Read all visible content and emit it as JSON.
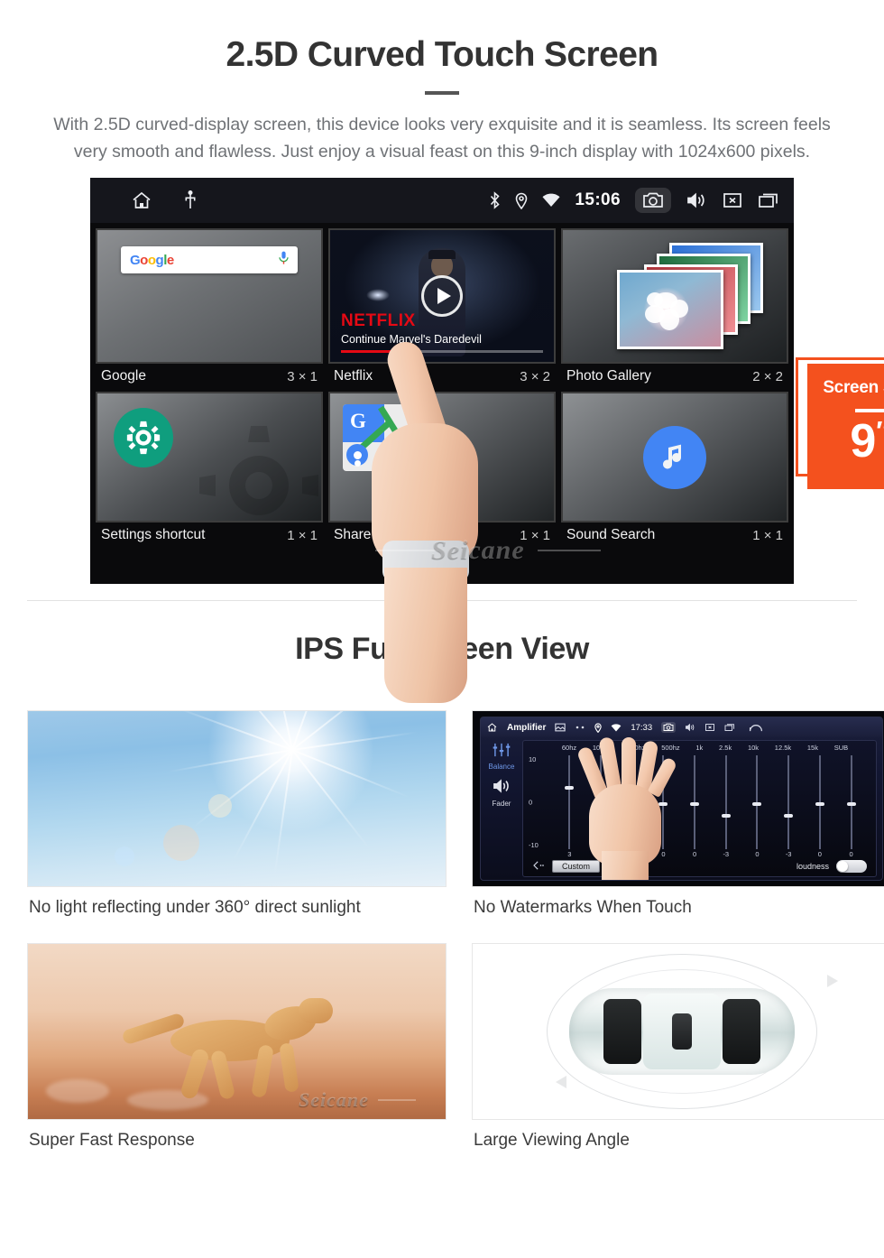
{
  "section1": {
    "title": "2.5D Curved Touch Screen",
    "description": "With 2.5D curved-display screen, this device looks very exquisite and it is seamless. Its screen feels very smooth and flawless. Just enjoy a visual feast on this 9-inch display with 1024x600 pixels."
  },
  "badge": {
    "title": "Screen Size",
    "value": "9",
    "unit": "″",
    "color": "#F4511E"
  },
  "device": {
    "statusbar": {
      "home_icon": "home-icon",
      "usb_icon": "usb-icon",
      "bluetooth_icon": "bluetooth-icon",
      "location_icon": "location-pin-icon",
      "wifi_icon": "wifi-icon",
      "time": "15:06",
      "camera_icon": "camera-icon",
      "volume_icon": "volume-icon",
      "close_icon": "close-box-icon",
      "recents_icon": "recent-apps-icon"
    },
    "widgets": [
      {
        "label": "Google",
        "size": "3 × 1",
        "icon": "google-search-widget"
      },
      {
        "label": "Netflix",
        "size": "3 × 2",
        "icon": "netflix-widget"
      },
      {
        "label": "Photo Gallery",
        "size": "2 × 2",
        "icon": "photo-gallery-widget"
      },
      {
        "label": "Settings shortcut",
        "size": "1 × 1",
        "icon": "settings-gear-icon"
      },
      {
        "label": "Share location",
        "size": "1 × 1",
        "icon": "google-maps-icon"
      },
      {
        "label": "Sound Search",
        "size": "1 × 1",
        "icon": "music-note-icon"
      }
    ],
    "google_widget": {
      "logo": "Google",
      "mic_icon": "microphone-icon"
    },
    "netflix_widget": {
      "brand": "NETFLIX",
      "subtitle": "Continue Marvel's Daredevil",
      "play_icon": "play-icon"
    },
    "watermark": "Seicane"
  },
  "section2": {
    "title": "IPS Full Screen View",
    "cards": [
      {
        "caption": "No light reflecting under 360° direct sunlight",
        "image": "blue-sky-sun-photo"
      },
      {
        "caption": "No Watermarks When Touch",
        "image": "amplifier-equalizer-screenshot"
      },
      {
        "caption": "Super Fast Response",
        "image": "running-cheetah-photo"
      },
      {
        "caption": "Large Viewing Angle",
        "image": "car-top-view-diagram"
      }
    ]
  },
  "amplifier": {
    "title": "Amplifier",
    "time": "17:33",
    "icons": [
      "gallery-icon",
      "dots-icon",
      "location-pin-icon",
      "wifi-icon",
      "camera-icon",
      "volume-icon",
      "close-box-icon",
      "recent-apps-icon",
      "back-icon"
    ],
    "sidebar": [
      {
        "label": "Balance",
        "icon": "sliders-icon"
      },
      {
        "label": "Fader",
        "icon": "speaker-icon"
      }
    ],
    "scale": [
      "10",
      "0",
      "-10"
    ],
    "bands": [
      "60hz",
      "100hz",
      "200hz",
      "500hz",
      "1k",
      "2.5k",
      "10k",
      "12.5k",
      "15k",
      "SUB"
    ],
    "values": [
      "3",
      "-4",
      "0",
      "0",
      "0",
      "-3",
      "0",
      "-3",
      "0",
      "0"
    ],
    "preset_button": "Custom",
    "back_icon": "back-arrow-icon",
    "loudness_label": "loudness",
    "loudness_on": false
  },
  "watermarks": {
    "brand": "Seicane"
  }
}
